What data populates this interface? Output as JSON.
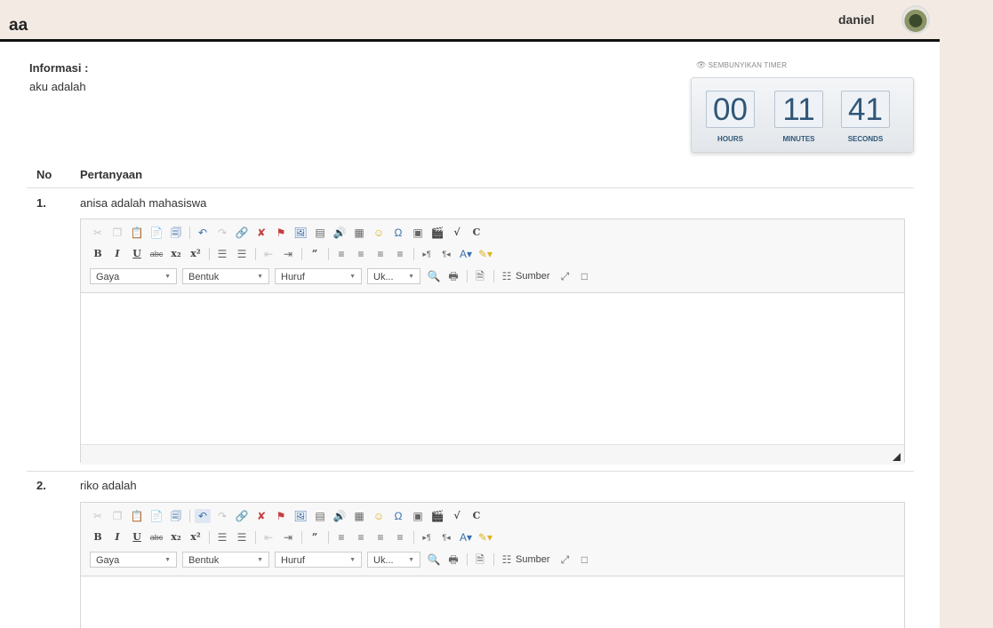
{
  "header": {
    "title": "aa",
    "username": "daniel"
  },
  "info": {
    "label": "Informasi :",
    "text": "aku adalah"
  },
  "timer": {
    "hide_label": "SEMBUNYIKAN TIMER",
    "hours": "00",
    "minutes": "11",
    "seconds": "41",
    "hours_label": "HOURS",
    "minutes_label": "MINUTES",
    "seconds_label": "SECONDS"
  },
  "table": {
    "col_no": "No",
    "col_question": "Pertanyaan"
  },
  "questions": [
    {
      "no": "1.",
      "text": "anisa adalah mahasiswa"
    },
    {
      "no": "2.",
      "text": "riko adalah"
    }
  ],
  "editor": {
    "combo_style": "Gaya",
    "combo_format": "Bentuk",
    "combo_font": "Huruf",
    "combo_size": "Uk...",
    "source_label": "Sumber"
  }
}
